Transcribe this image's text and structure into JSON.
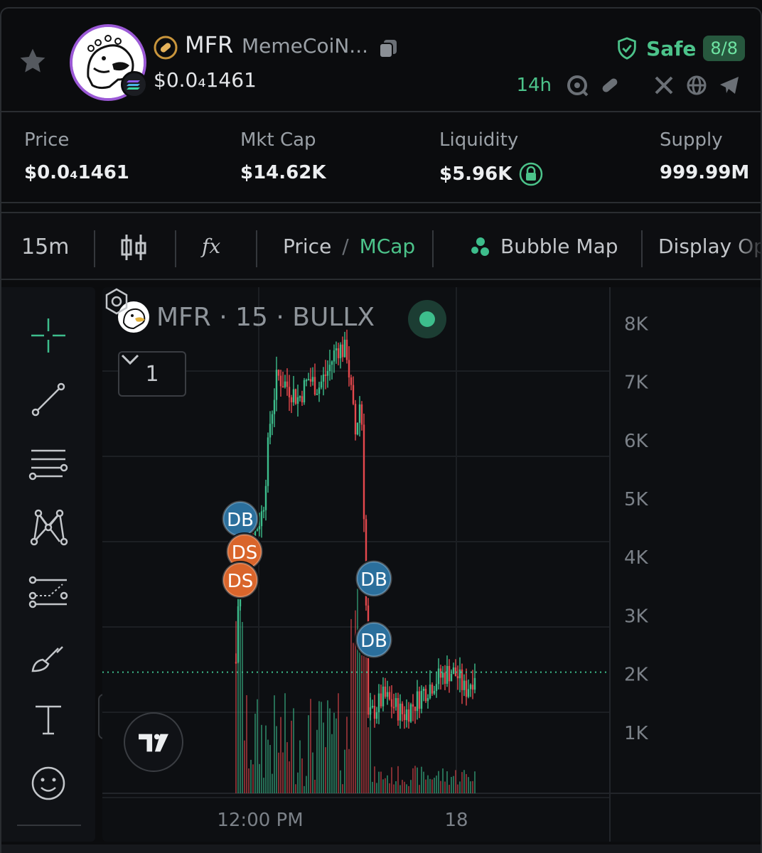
{
  "token": {
    "ticker": "MFR",
    "name": "MemeCoiN...",
    "price": "$0.0₄1461",
    "age": "14h",
    "safety": {
      "label": "Safe",
      "score": "8/8"
    }
  },
  "stats": [
    {
      "label": "Price",
      "value": "$0.0₄1461"
    },
    {
      "label": "Mkt Cap",
      "value": "$14.62K"
    },
    {
      "label": "Liquidity",
      "value": "$5.96K"
    },
    {
      "label": "Supply",
      "value": "999.99M"
    }
  ],
  "toolbar": {
    "interval": "15m",
    "fx_label": "fx",
    "price_label": "Price",
    "separator": "/",
    "mcap_label": "MCap",
    "bubble_map_label": "Bubble Map",
    "display_options_label": "Display Op"
  },
  "chart": {
    "legend": "MFR · 15 · BULLX",
    "collapse_count": "1",
    "markers": [
      {
        "label": "DB",
        "type": "buy"
      },
      {
        "label": "DS",
        "type": "sell"
      },
      {
        "label": "DS",
        "type": "sell"
      },
      {
        "label": "DB",
        "type": "buy"
      },
      {
        "label": "DB",
        "type": "buy"
      }
    ]
  },
  "chart_data": {
    "type": "candlestick",
    "y_axis_labels": [
      "8K",
      "7K",
      "6K",
      "5K",
      "4K",
      "3K",
      "2K",
      "1K"
    ],
    "x_axis_labels": [
      "12:00 PM",
      "18"
    ],
    "ylim": [
      0,
      8500
    ],
    "current_value": 2000,
    "colors": {
      "up": "#3dbd8c",
      "down": "#e5484d",
      "marker_buy": "#2b6f9c",
      "marker_sell": "#d9652b"
    }
  },
  "colors": {
    "accent_green": "#4cc38a",
    "background": "#0b0c0e"
  }
}
